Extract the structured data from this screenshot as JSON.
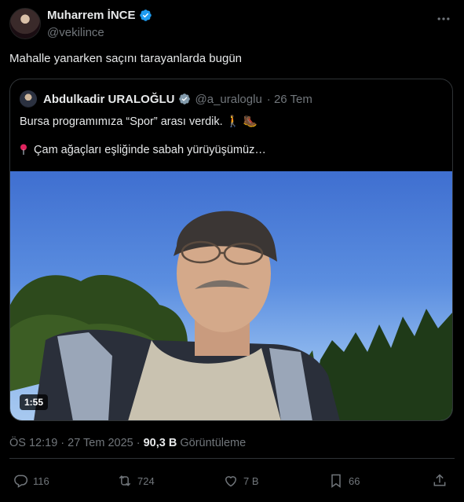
{
  "author": {
    "name": "Muharrem İNCE",
    "handle": "@vekilince"
  },
  "tweet": {
    "text": "Mahalle yanarken saçını tarayanlarda bugün"
  },
  "quote": {
    "name": "Abdulkadir URALOĞLU",
    "handle": "@a_uraloglu",
    "date": "· 26 Tem",
    "line1": "Bursa programımıza “Spor” arası verdik.",
    "line2": "Çam ağaçları eşliğinde sabah yürüyüşümüz…",
    "video_duration": "1:55"
  },
  "meta": {
    "time": "ÖS 12:19 · 27 Tem 2025 · ",
    "views": "90,3 B",
    "views_label": "Görüntüleme"
  },
  "actions": {
    "replies": "116",
    "reposts": "724",
    "likes": "7 B",
    "bookmarks": "66"
  },
  "colors": {
    "background": "#000000",
    "text": "#e7e9ea",
    "secondary": "#71767b",
    "verified": "#1d9bf0",
    "border": "#2f3336"
  }
}
